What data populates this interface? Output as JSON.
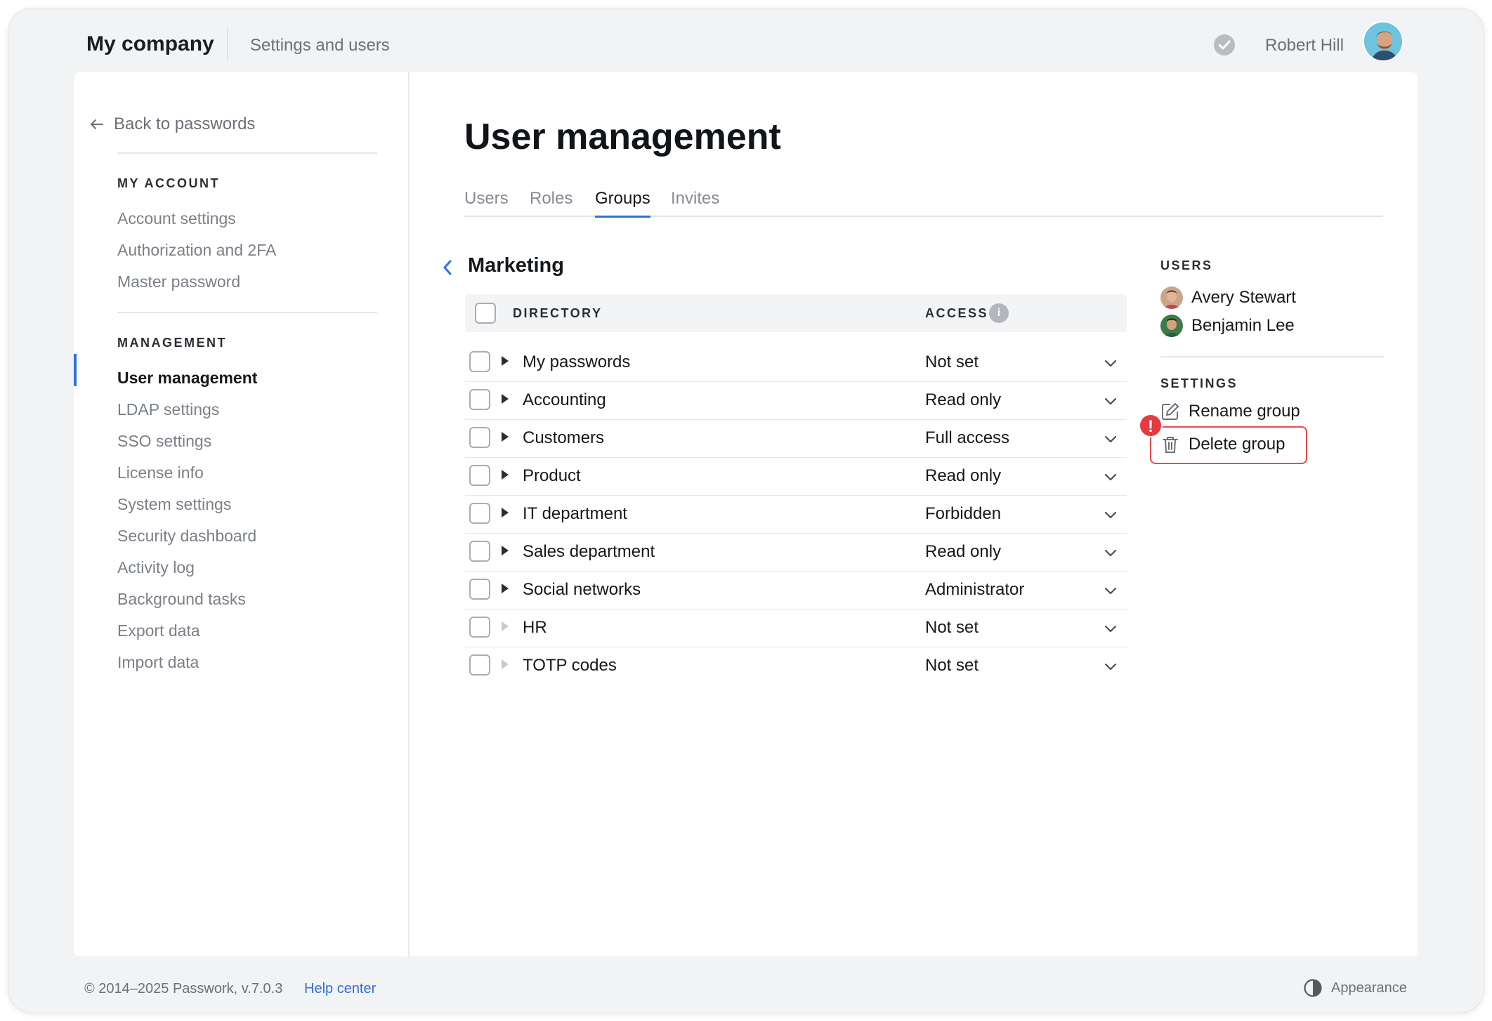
{
  "header": {
    "company": "My company",
    "subtitle": "Settings and users",
    "user_name": "Robert Hill"
  },
  "sidebar": {
    "back_label": "Back to passwords",
    "my_account_heading": "MY ACCOUNT",
    "my_account_items": [
      "Account settings",
      "Authorization and 2FA",
      "Master password"
    ],
    "management_heading": "MANAGEMENT",
    "management_items": [
      "User management",
      "LDAP settings",
      "SSO settings",
      "License info",
      "System settings",
      "Security dashboard",
      "Activity log",
      "Background tasks",
      "Export data",
      "Import data"
    ],
    "active_item": "User management"
  },
  "main": {
    "title": "User management",
    "tabs": [
      "Users",
      "Roles",
      "Groups",
      "Invites"
    ],
    "active_tab": "Groups",
    "group_name": "Marketing",
    "table": {
      "col_directory": "DIRECTORY",
      "col_access": "ACCESS",
      "info_icon_label": "i",
      "rows": [
        {
          "name": "My passwords",
          "access": "Not set",
          "expandable": true
        },
        {
          "name": "Accounting",
          "access": "Read only",
          "expandable": true
        },
        {
          "name": "Customers",
          "access": "Full access",
          "expandable": true
        },
        {
          "name": "Product",
          "access": "Read only",
          "expandable": true
        },
        {
          "name": "IT department",
          "access": "Forbidden",
          "expandable": true
        },
        {
          "name": "Sales department",
          "access": "Read only",
          "expandable": true
        },
        {
          "name": "Social networks",
          "access": "Administrator",
          "expandable": true
        },
        {
          "name": "HR",
          "access": "Not set",
          "expandable": false
        },
        {
          "name": "TOTP codes",
          "access": "Not set",
          "expandable": false
        }
      ]
    }
  },
  "right_panel": {
    "users_heading": "USERS",
    "users": [
      "Avery Stewart",
      "Benjamin Lee"
    ],
    "settings_heading": "SETTINGS",
    "rename_label": "Rename group",
    "delete_label": "Delete group",
    "alert_mark": "!"
  },
  "footer": {
    "copyright": "© 2014–2025 Passwork, v.7.0.3",
    "help_label": "Help center",
    "appearance_label": "Appearance"
  },
  "colors": {
    "accent": "#2f6fde",
    "danger": "#e53a3f",
    "background": "#f2f3f5"
  },
  "icons": {
    "back": "arrow-left-icon",
    "status": "check-circle-icon",
    "group_back": "chevron-left-icon",
    "row_toggle": "triangle-right-icon",
    "access_dropdown": "chevron-down-icon",
    "rename": "edit-icon",
    "delete": "trash-icon",
    "appearance": "contrast-icon"
  }
}
